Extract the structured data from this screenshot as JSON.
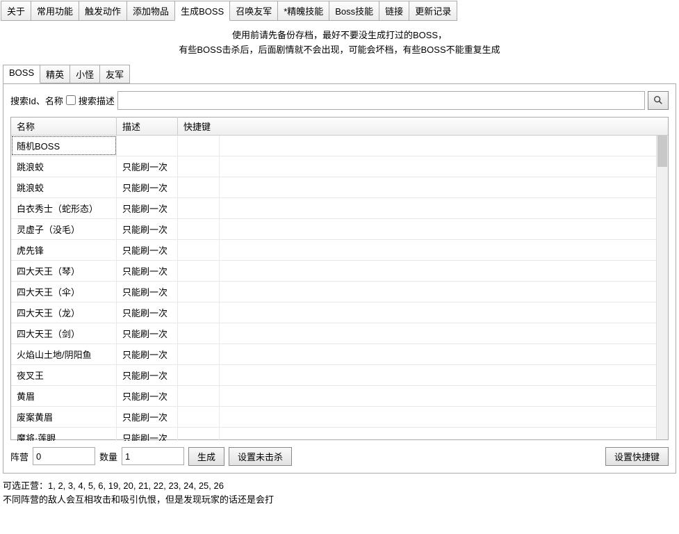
{
  "mainTabs": [
    {
      "label": "关于"
    },
    {
      "label": "常用功能"
    },
    {
      "label": "触发动作"
    },
    {
      "label": "添加物品"
    },
    {
      "label": "生成BOSS",
      "active": true
    },
    {
      "label": "召唤友军"
    },
    {
      "label": "*精魄技能"
    },
    {
      "label": "Boss技能"
    },
    {
      "label": "链接"
    },
    {
      "label": "更新记录"
    }
  ],
  "info": {
    "line1": "使用前请先备份存档，最好不要没生成打过的BOSS，",
    "line2": "有些BOSS击杀后，后面剧情就不会出现，可能会坏档，有些BOSS不能重复生成"
  },
  "subTabs": [
    {
      "label": "BOSS",
      "active": true
    },
    {
      "label": "精英"
    },
    {
      "label": "小怪"
    },
    {
      "label": "友军"
    }
  ],
  "search": {
    "label1": "搜索Id、名称",
    "checkboxLabel": "搜索描述",
    "placeholder": ""
  },
  "table": {
    "headers": {
      "name": "名称",
      "desc": "描述",
      "hotkey": "快捷键"
    },
    "rows": [
      {
        "name": "随机BOSS",
        "desc": "",
        "hotkey": "",
        "selected": true
      },
      {
        "name": "跳浪蛟",
        "desc": "只能刷一次",
        "hotkey": ""
      },
      {
        "name": "跳浪蛟",
        "desc": "只能刷一次",
        "hotkey": ""
      },
      {
        "name": "白衣秀士（蛇形态）",
        "desc": "只能刷一次",
        "hotkey": ""
      },
      {
        "name": "灵虚子（没毛）",
        "desc": "只能刷一次",
        "hotkey": ""
      },
      {
        "name": "虎先锋",
        "desc": "只能刷一次",
        "hotkey": ""
      },
      {
        "name": "四大天王（琴）",
        "desc": "只能刷一次",
        "hotkey": ""
      },
      {
        "name": "四大天王（伞）",
        "desc": "只能刷一次",
        "hotkey": ""
      },
      {
        "name": "四大天王（龙）",
        "desc": "只能刷一次",
        "hotkey": ""
      },
      {
        "name": "四大天王（剑）",
        "desc": "只能刷一次",
        "hotkey": ""
      },
      {
        "name": "火焰山土地/阴阳鱼",
        "desc": "只能刷一次",
        "hotkey": ""
      },
      {
        "name": "夜叉王",
        "desc": "只能刷一次",
        "hotkey": ""
      },
      {
        "name": "黄眉",
        "desc": "只能刷一次",
        "hotkey": ""
      },
      {
        "name": "废案黄眉",
        "desc": "只能刷一次",
        "hotkey": ""
      },
      {
        "name": "魔将·莲眼",
        "desc": "只能刷一次",
        "hotkey": ""
      }
    ]
  },
  "controls": {
    "campLabel": "阵营",
    "campValue": "0",
    "countLabel": "数量",
    "countValue": "1",
    "generateBtn": "生成",
    "setNotKilledBtn": "设置未击杀",
    "setHotkeyBtn": "设置快捷键"
  },
  "footer": {
    "line1": "可选正营：1, 2, 3, 4, 5, 6, 19, 20, 21, 22, 23, 24, 25, 26",
    "line2": "不同阵营的敌人会互相攻击和吸引仇恨，但是发现玩家的话还是会打"
  }
}
